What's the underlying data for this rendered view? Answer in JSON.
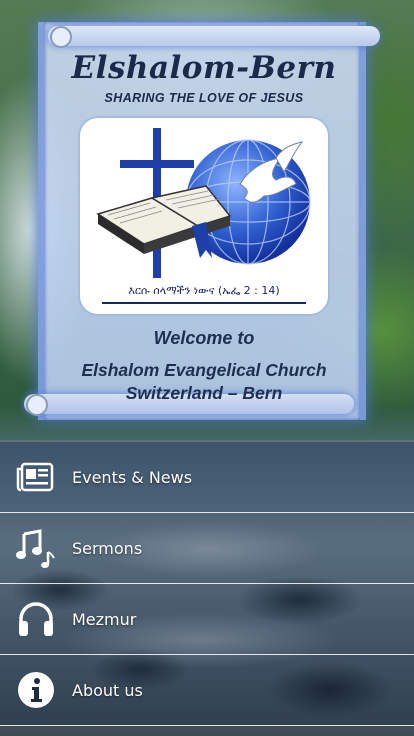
{
  "banner": {
    "title": "Elshalom-Bern",
    "tagline": "SHARING THE LOVE OF JESUS",
    "logo_verse": "እርሱ ሰላማችን ነውና (ኤፌ 2 : 14)",
    "welcome": "Welcome to",
    "church_line1": "Elshalom Evangelical Church",
    "church_line2": "Switzerland – Bern"
  },
  "menu": {
    "items": [
      {
        "label": "Events & News",
        "icon": "newspaper-icon"
      },
      {
        "label": "Sermons",
        "icon": "music-notes-icon"
      },
      {
        "label": "Mezmur",
        "icon": "headphones-icon"
      },
      {
        "label": "About us",
        "icon": "info-icon"
      }
    ]
  },
  "colors": {
    "title_navy": "#1c2a4a",
    "scroll_glow": "#5078dc",
    "logo_blue": "#1a2560",
    "menu_text": "#ffffff"
  }
}
